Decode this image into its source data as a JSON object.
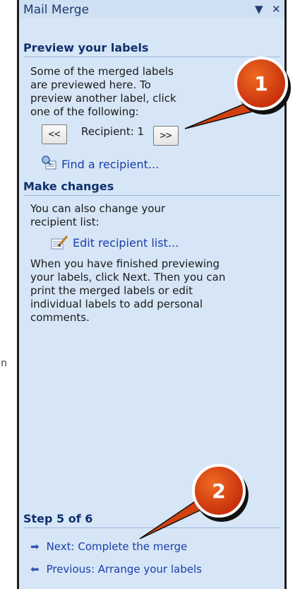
{
  "edge_text": "n",
  "pane": {
    "title": "Mail Merge",
    "dropdown_icon": "triangle-down-icon",
    "close_icon": "close-icon"
  },
  "preview": {
    "heading": "Preview your labels",
    "body": "Some of the merged labels are previewed here. To preview another label, click one of the following:",
    "prev_label": "<<",
    "recipient_text": "Recipient: 1",
    "next_label": ">>",
    "find_link": "Find a recipient..."
  },
  "changes": {
    "heading": "Make changes",
    "body": "You can also change your recipient list:",
    "edit_link": "Edit recipient list...",
    "finish_text": "When you have finished previewing your labels, click Next. Then you can print the merged labels or edit individual labels to add personal comments."
  },
  "step": {
    "heading": "Step 5 of 6",
    "next_link": "Next: Complete the merge",
    "prev_link": "Previous: Arrange your labels"
  },
  "callouts": {
    "first": "1",
    "second": "2"
  },
  "colors": {
    "accent": "#d2400f",
    "pane_bg": "#d6e6f7",
    "link": "#1b3ea8"
  }
}
